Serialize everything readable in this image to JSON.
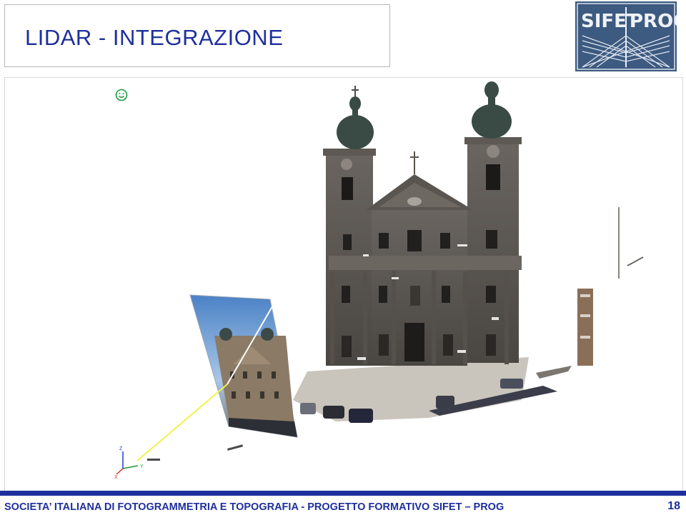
{
  "slide": {
    "title": "LIDAR - INTEGRAZIONE",
    "footer": "SOCIETA’ ITALIANA DI FOTOGRAMMETRIA E TOPOGRAFIA  -  PROGETTO FORMATIVO SIFET – PROG",
    "page_number": "18"
  },
  "logo": {
    "line1_left": "SIFET",
    "line1_right": "PROG",
    "background": "#3d5a80"
  },
  "viewer": {
    "bullet_icon": "smiley-icon",
    "axes": {
      "z": "Z",
      "y": "Y",
      "x": "X"
    }
  },
  "colors": {
    "title": "#1e2f9c",
    "footer_bar": "#1e2f9c",
    "bullet": "#1a9a3a"
  }
}
